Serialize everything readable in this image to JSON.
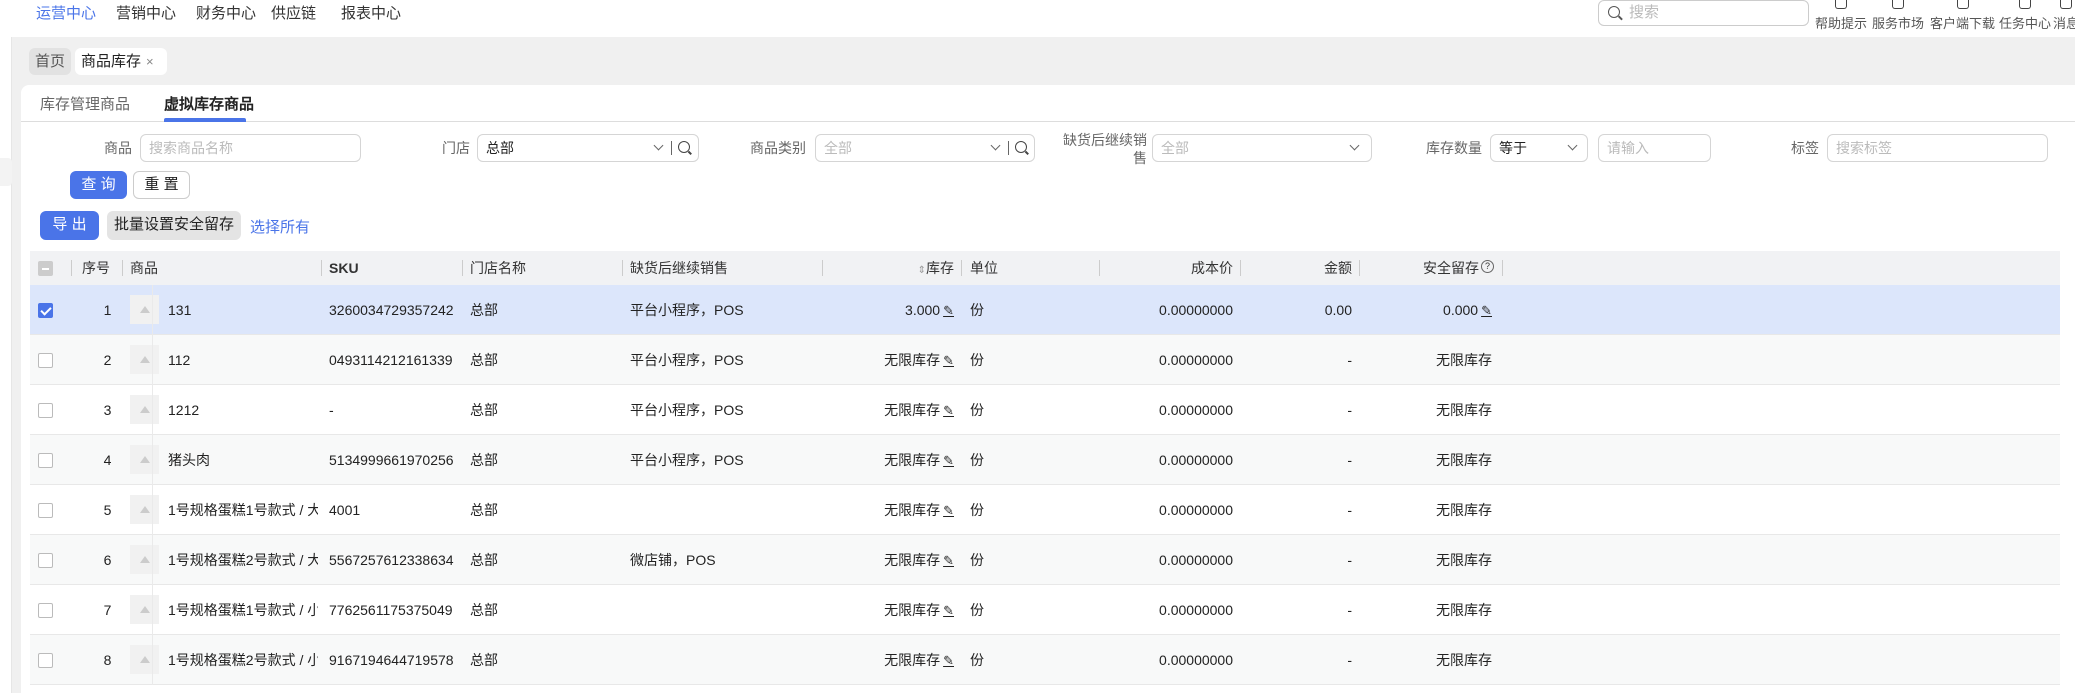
{
  "topnav": {
    "items": [
      "运营中心",
      "营销中心",
      "财务中心",
      "供应链",
      "报表中心"
    ],
    "active": 0
  },
  "search": {
    "placeholder": "搜索"
  },
  "tools": [
    "帮助提示",
    "服务市场",
    "客户端下载",
    "任务中心",
    "消息"
  ],
  "page_tabs": {
    "home": "首页",
    "current": "商品库存",
    "close": "×"
  },
  "sub_tabs": [
    "库存管理商品",
    "虚拟库存商品"
  ],
  "filters": {
    "product": {
      "label": "商品",
      "placeholder": "搜索商品名称"
    },
    "store": {
      "label": "门店",
      "value": "总部"
    },
    "category": {
      "label": "商品类别",
      "placeholder": "全部"
    },
    "continue_sale": {
      "label": "缺货后继续销售",
      "placeholder": "全部"
    },
    "stock_qty": {
      "label": "库存数量",
      "operator": "等于",
      "placeholder": "请输入"
    },
    "tag": {
      "label": "标签",
      "placeholder": "搜索标签"
    }
  },
  "buttons": {
    "query": "查 询",
    "reset": "重 置",
    "export": "导 出",
    "batch_safety": "批量设置安全留存",
    "select_all": "选择所有"
  },
  "table": {
    "headers": {
      "index": "序号",
      "product": "商品",
      "sku": "SKU",
      "store": "门店名称",
      "continue_sale": "缺货后继续销售",
      "stock": "库存",
      "unit": "单位",
      "cost": "成本价",
      "amount": "金额",
      "safety": "安全留存"
    },
    "rows": [
      {
        "index": "1",
        "product": "131",
        "sku": "3260034729357242",
        "store": "总部",
        "continue_sale": "平台小程序，POS",
        "stock": "3.000",
        "unit": "份",
        "cost": "0.00000000",
        "amount": "0.00",
        "safety": "0.000",
        "selected": true
      },
      {
        "index": "2",
        "product": "112",
        "sku": "0493114212161339",
        "store": "总部",
        "continue_sale": "平台小程序，POS",
        "stock": "无限库存",
        "unit": "份",
        "cost": "0.00000000",
        "amount": "-",
        "safety": "无限库存"
      },
      {
        "index": "3",
        "product": "1212",
        "sku": "-",
        "store": "总部",
        "continue_sale": "平台小程序，POS",
        "stock": "无限库存",
        "unit": "份",
        "cost": "0.00000000",
        "amount": "-",
        "safety": "无限库存"
      },
      {
        "index": "4",
        "product": "猪头肉",
        "sku": "5134999661970256",
        "store": "总部",
        "continue_sale": "平台小程序，POS",
        "stock": "无限库存",
        "unit": "份",
        "cost": "0.00000000",
        "amount": "-",
        "safety": "无限库存"
      },
      {
        "index": "5",
        "product": "1号规格蛋糕1号款式 / 大",
        "sku": "4001",
        "store": "总部",
        "continue_sale": "",
        "stock": "无限库存",
        "unit": "份",
        "cost": "0.00000000",
        "amount": "-",
        "safety": "无限库存"
      },
      {
        "index": "6",
        "product": "1号规格蛋糕2号款式 / 大",
        "sku": "5567257612338634",
        "store": "总部",
        "continue_sale": "微店铺，POS",
        "stock": "无限库存",
        "unit": "份",
        "cost": "0.00000000",
        "amount": "-",
        "safety": "无限库存"
      },
      {
        "index": "7",
        "product": "1号规格蛋糕1号款式 / 小",
        "sku": "7762561175375049",
        "store": "总部",
        "continue_sale": "",
        "stock": "无限库存",
        "unit": "份",
        "cost": "0.00000000",
        "amount": "-",
        "safety": "无限库存"
      },
      {
        "index": "8",
        "product": "1号规格蛋糕2号款式 / 小",
        "sku": "9167194644719578",
        "store": "总部",
        "continue_sale": "",
        "stock": "无限库存",
        "unit": "份",
        "cost": "0.00000000",
        "amount": "-",
        "safety": "无限库存"
      }
    ]
  },
  "colors": {
    "accent": "#4a74e8",
    "selected_row": "#dce6fb"
  }
}
